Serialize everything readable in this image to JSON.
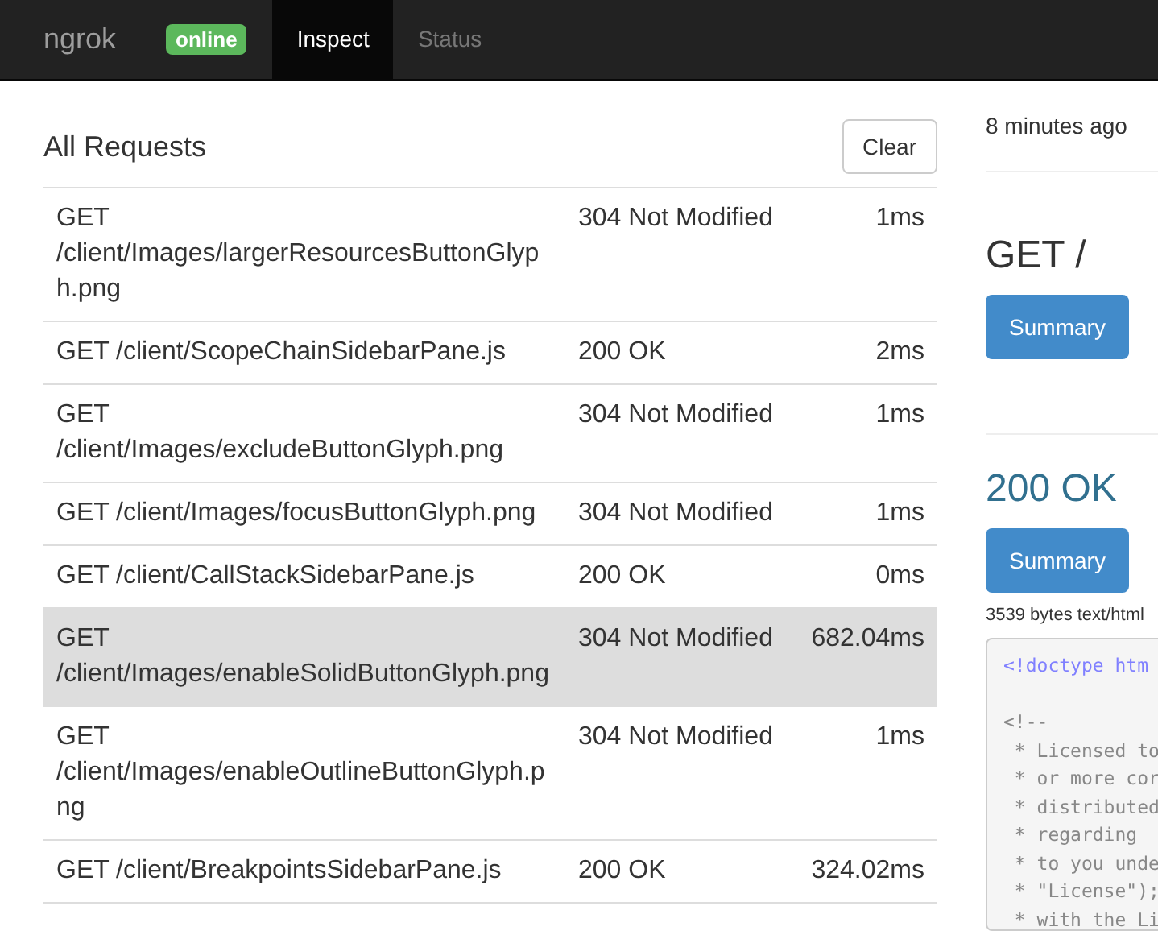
{
  "navbar": {
    "brand": "ngrok",
    "status_badge": "online",
    "tabs": [
      {
        "label": "Inspect",
        "selected": true
      },
      {
        "label": "Status",
        "selected": false
      }
    ]
  },
  "requests": {
    "title": "All Requests",
    "clear_button": "Clear",
    "rows": [
      {
        "request": "GET /client/Images/largerResourcesButtonGlyph.png",
        "status": "304 Not Modified",
        "duration": "1ms",
        "selected": false
      },
      {
        "request": "GET /client/ScopeChainSidebarPane.js",
        "status": "200 OK",
        "duration": "2ms",
        "selected": false
      },
      {
        "request": "GET /client/Images/excludeButtonGlyph.png",
        "status": "304 Not Modified",
        "duration": "1ms",
        "selected": false
      },
      {
        "request": "GET /client/Images/focusButtonGlyph.png",
        "status": "304 Not Modified",
        "duration": "1ms",
        "selected": false
      },
      {
        "request": "GET /client/CallStackSidebarPane.js",
        "status": "200 OK",
        "duration": "0ms",
        "selected": false
      },
      {
        "request": "GET /client/Images/enableSolidButtonGlyph.png",
        "status": "304 Not Modified",
        "duration": "682.04ms",
        "selected": true
      },
      {
        "request": "GET /client/Images/enableOutlineButtonGlyph.png",
        "status": "304 Not Modified",
        "duration": "1ms",
        "selected": false
      },
      {
        "request": "GET /client/BreakpointsSidebarPane.js",
        "status": "200 OK",
        "duration": "324.02ms",
        "selected": false
      }
    ]
  },
  "detail": {
    "time_ago": "8 minutes ago",
    "request": {
      "title": "GET /",
      "tab": "Summary"
    },
    "response": {
      "title": "200 OK",
      "tab": "Summary",
      "info": "3539 bytes text/html",
      "code_lines": [
        {
          "kind": "doctype",
          "text": "<!doctype htm"
        },
        {
          "kind": "blank"
        },
        {
          "kind": "comment",
          "text": "<!--"
        },
        {
          "kind": "comment",
          "text": " * Licensed to"
        },
        {
          "kind": "comment",
          "text": " * or more cor"
        },
        {
          "kind": "comment",
          "text": " * distributed"
        },
        {
          "kind": "comment",
          "text": " * regarding"
        },
        {
          "kind": "comment",
          "text": " * to you unde"
        },
        {
          "kind": "comment",
          "text": " * \"License\");"
        },
        {
          "kind": "comment",
          "text": " * with the Li"
        }
      ]
    }
  }
}
